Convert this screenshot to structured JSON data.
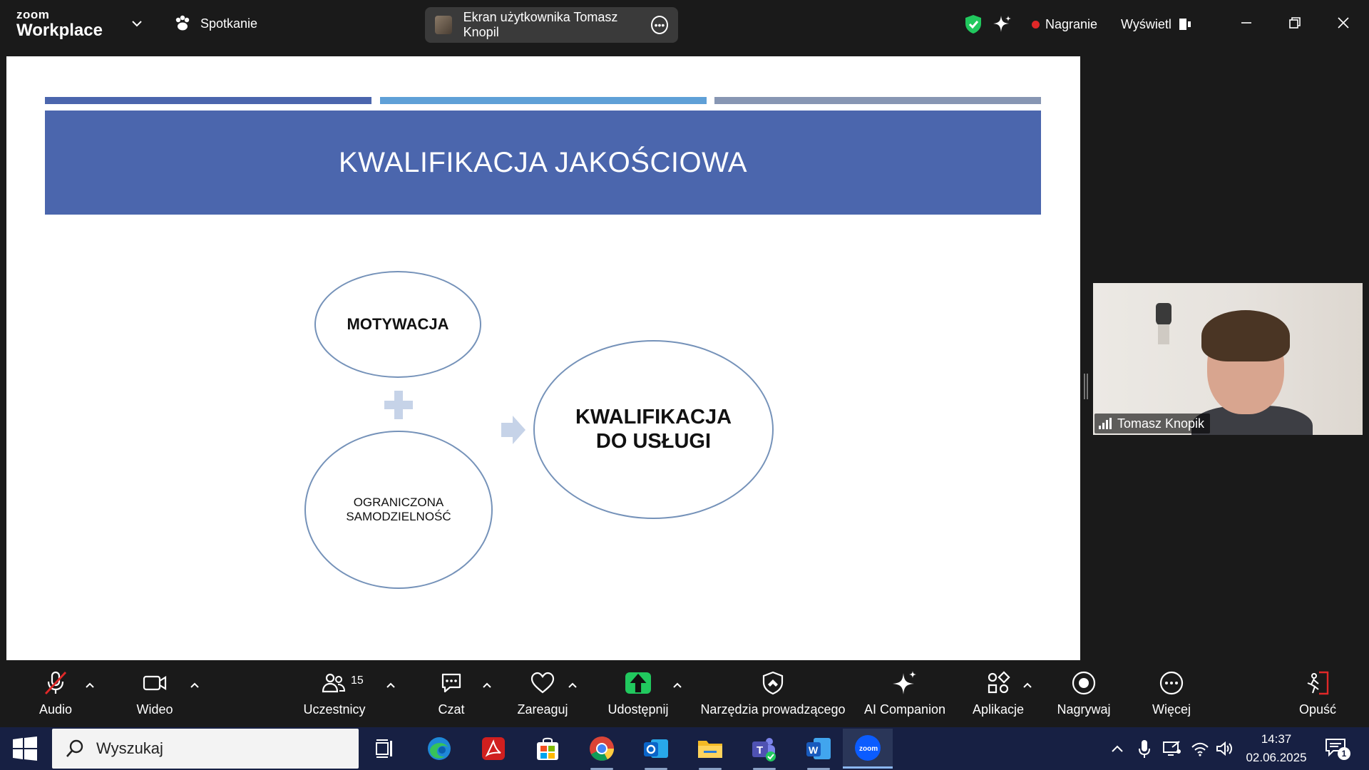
{
  "titlebar": {
    "brand_small": "zoom",
    "brand_main": "Workplace",
    "meeting_label": "Spotkanie",
    "screen_share_label": "Ekran użytkownika Tomasz Knopil",
    "recording_label": "Nagranie",
    "view_label": "Wyświetl"
  },
  "slide": {
    "title": "KWALIFIKACJA JAKOŚCIOWA",
    "top_bar_colors": [
      "#4b66ad",
      "#5fa0d7",
      "#8796b3"
    ],
    "nodes": {
      "motywacja": "MOTYWACJA",
      "ograniczona_line1": "OGRANICZONA",
      "ograniczona_line2": "SAMODZIELNOŚĆ",
      "kwalifikacja_line1": "KWALIFIKACJA",
      "kwalifikacja_line2": "DO USŁUGI"
    }
  },
  "participant": {
    "name": "Tomasz Knopik"
  },
  "toolbar": {
    "audio": "Audio",
    "video": "Wideo",
    "participants": "Uczestnicy",
    "participants_count": "15",
    "chat": "Czat",
    "react": "Zareaguj",
    "share": "Udostępnij",
    "host_tools": "Narzędzia prowadzącego",
    "ai_companion": "AI Companion",
    "apps": "Aplikacje",
    "record": "Nagrywaj",
    "more": "Więcej",
    "leave": "Opuść"
  },
  "taskbar": {
    "search_placeholder": "Wyszukaj",
    "time": "14:37",
    "date": "02.06.2025",
    "notifications_count": "1"
  },
  "colors": {
    "accent_green": "#21c85e",
    "record_red": "#e02828",
    "slide_header_blue": "#4b66ad",
    "taskbar_bg": "#172043"
  }
}
